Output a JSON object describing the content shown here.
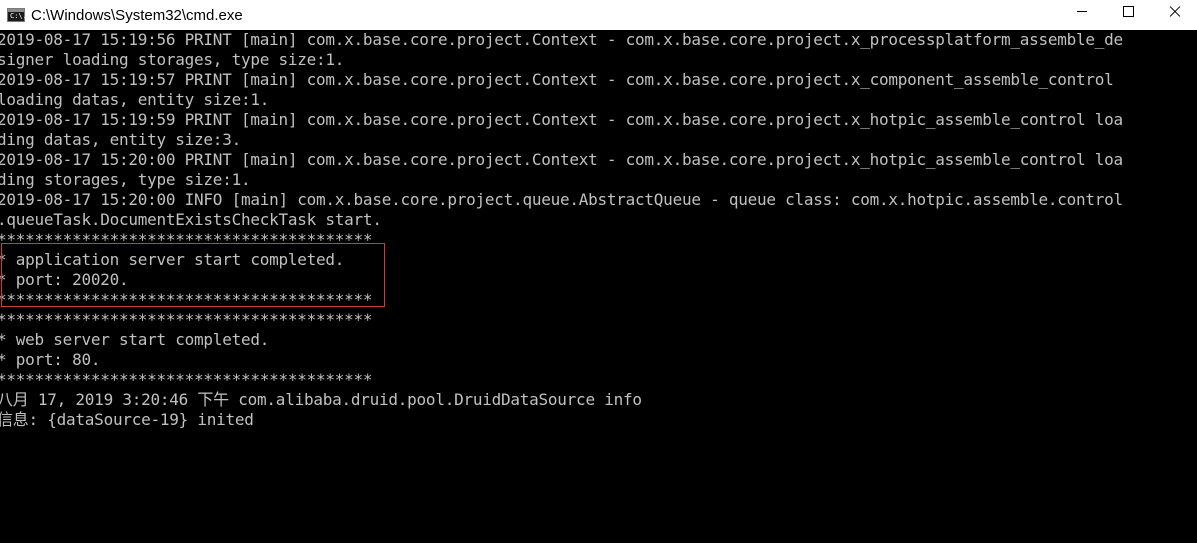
{
  "window": {
    "title": "C:\\Windows\\System32\\cmd.exe",
    "icon": "cmd-icon",
    "icon_text": "C:\\."
  },
  "console": {
    "lines": [
      "2019-08-17 15:19:56 PRINT [main] com.x.base.core.project.Context - com.x.base.core.project.x_processplatform_assemble_de",
      "signer loading storages, type size:1.",
      "2019-08-17 15:19:57 PRINT [main] com.x.base.core.project.Context - com.x.base.core.project.x_component_assemble_control",
      "loading datas, entity size:1.",
      "2019-08-17 15:19:59 PRINT [main] com.x.base.core.project.Context - com.x.base.core.project.x_hotpic_assemble_control loa",
      "ding datas, entity size:3.",
      "2019-08-17 15:20:00 PRINT [main] com.x.base.core.project.Context - com.x.base.core.project.x_hotpic_assemble_control loa",
      "ding storages, type size:1.",
      "2019-08-17 15:20:00 INFO [main] com.x.base.core.project.queue.AbstractQueue - queue class: com.x.hotpic.assemble.control",
      ".queueTask.DocumentExistsCheckTask start.",
      "****************************************",
      "* application server start completed.",
      "* port: 20020.",
      "****************************************",
      "****************************************",
      "* web server start completed.",
      "* port: 80.",
      "****************************************",
      "八月 17, 2019 3:20:46 下午 com.alibaba.druid.pool.DruidDataSource info",
      "信息: {dataSource-19} inited"
    ]
  },
  "colors": {
    "background": "#000000",
    "text": "#c0c0c0",
    "highlight_border": "#d23a3a"
  }
}
